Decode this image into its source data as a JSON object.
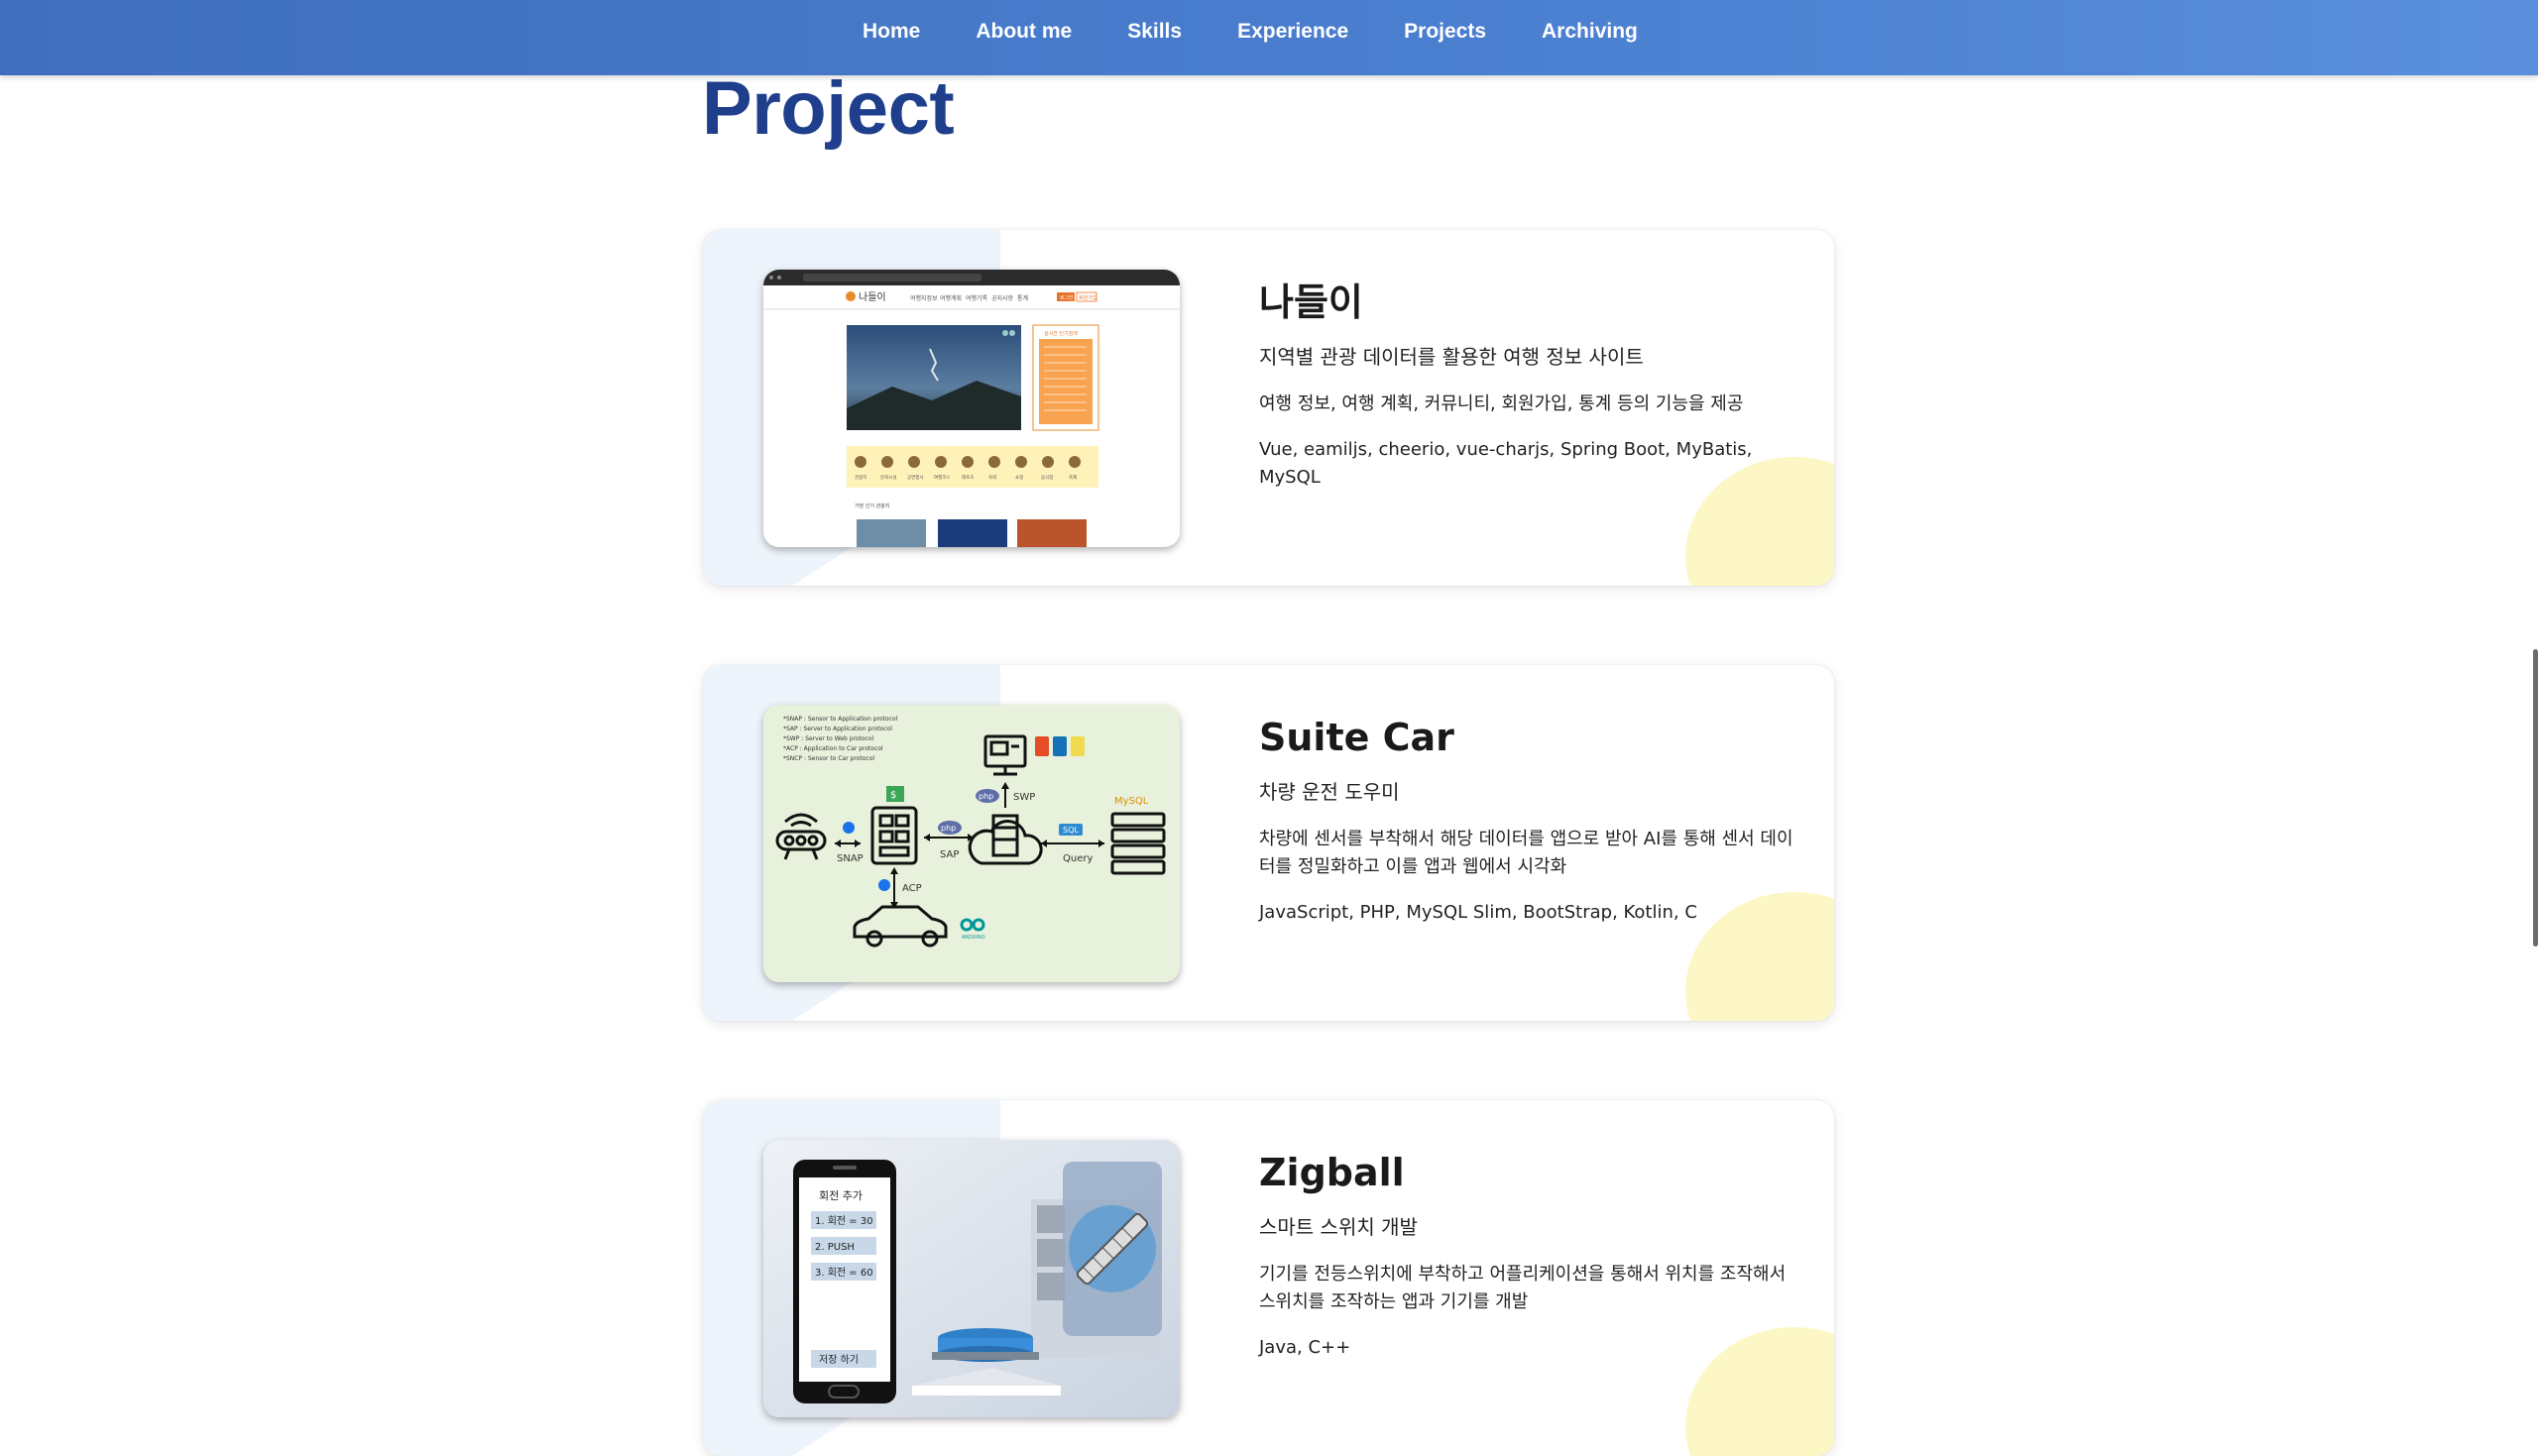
{
  "nav": {
    "items": [
      {
        "label": "Home"
      },
      {
        "label": "About me"
      },
      {
        "label": "Skills"
      },
      {
        "label": "Experience"
      },
      {
        "label": "Projects"
      },
      {
        "label": "Archiving"
      }
    ]
  },
  "page": {
    "title": "Project"
  },
  "projects": [
    {
      "title": "나들이",
      "subtitle": "지역별 관광 데이터를 활용한 여행 정보 사이트",
      "description": "여행 정보, 여행 계획, 커뮤니티, 회원가입, 통계 등의 기능을 제공",
      "tech": "Vue, eamiljs, cheerio, vue-charjs, Spring Boot, MyBatis, MySQL"
    },
    {
      "title": "Suite Car",
      "subtitle": "차량 운전 도우미",
      "description": "차량에 센서를 부착해서 해당 데이터를 앱으로 받아 AI를 통해 센서 데이터를 정밀화하고 이를 앱과 웹에서 시각화",
      "tech": "JavaScript, PHP, MySQL Slim, BootStrap, Kotlin, C",
      "diagram": {
        "notes": [
          "*SNAP : Sensor to Application protocol",
          "*SAP : Server to Application protocol",
          "*SWP : Server to Web protocol",
          "*ACP : Application to Car protocol",
          "*SNCP : Sensor to Car protocol"
        ],
        "labels": {
          "snap": "SNAP",
          "sap": "SAP",
          "swp": "SWP",
          "acp": "ACP",
          "query": "Query",
          "php": "php",
          "sql": "SQL",
          "mysql": "MySQL",
          "dollar": "$",
          "arduino": "ARDUINO"
        }
      }
    },
    {
      "title": "Zigball",
      "subtitle": "스마트 스위치 개발",
      "description": "기기를 전등스위치에 부착하고 어플리케이션을 통해서 위치를 조작해서 스위치를 조작하는 앱과 기기를 개발",
      "tech": "Java, C++",
      "phone": {
        "header": "회전 추가",
        "items": [
          "1. 회전 = 30",
          "2. PUSH",
          "3. 회전 = 60"
        ],
        "save": "저장 하기"
      }
    }
  ],
  "thumb1": {
    "logo": "나들이",
    "menu": [
      "여행지정보",
      "여행계획",
      "여행기록",
      "공지사항",
      "통계"
    ],
    "auth": [
      "로그인",
      "회원가입"
    ],
    "panel_title": "실시간 인기검색",
    "section": "가장 인기 관광지",
    "cats": [
      "관광지",
      "문화시설",
      "공연행사",
      "여행코스",
      "레포츠",
      "숙박",
      "쇼핑",
      "음식점",
      "축제"
    ]
  },
  "colors": {
    "nav": "#4b7fd0",
    "title": "#1f3f8c",
    "card_left": "#eef4fb",
    "card_blob": "#fdf7c6"
  }
}
